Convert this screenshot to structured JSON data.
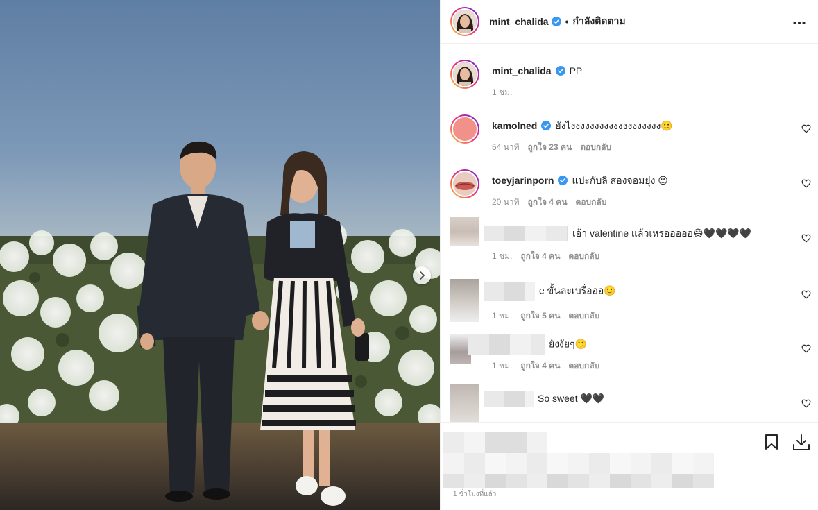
{
  "post_author": {
    "username": "mint_chalida",
    "follow_state": "กำลังติดตาม",
    "separator": "•"
  },
  "caption": {
    "username": "mint_chalida",
    "text": "PP",
    "time": "1 ชม."
  },
  "comments": [
    {
      "username": "kamolned",
      "text": "ยังไงงงงงงงงงงงงงงงงงงง🙂",
      "time": "54 นาที",
      "likes": "ถูกใจ 23 คน",
      "reply": "ตอบกลับ",
      "verified": true
    },
    {
      "username": "toeyjarinporn",
      "text": "แปะกับลิ สองจอมยุ่ง 😉",
      "time": "20 นาที",
      "likes": "ถูกใจ 4 คน",
      "reply": "ตอบกลับ",
      "verified": true
    },
    {
      "username": "",
      "text": "เอ้า valentine แล้วเหรอออออ😅🖤🖤🖤🖤",
      "time": "1 ชม.",
      "likes": "ถูกใจ 4 คน",
      "reply": "ตอบกลับ",
      "verified": false
    },
    {
      "username": "",
      "text": "e ขั้นละเบรื่อออ🙂",
      "time": "1 ชม.",
      "likes": "ถูกใจ 5 คน",
      "reply": "ตอบกลับ",
      "verified": false
    },
    {
      "username": "",
      "text": "ยังงัยๆ🙂",
      "time": "1 ชม.",
      "likes": "ถูกใจ 4 คน",
      "reply": "ตอบกลับ",
      "verified": false
    },
    {
      "username": "",
      "text": "So sweet 🖤🖤",
      "time": "",
      "likes": "",
      "reply": "",
      "verified": false
    }
  ],
  "footer": {
    "time": "1 ชั่วโมงที่แล้ว"
  },
  "icons": [
    "verified-badge-icon",
    "more-options-icon",
    "heart-icon",
    "next-arrow-icon",
    "save-bookmark-icon",
    "download-icon"
  ],
  "colors": {
    "verified": "#3897f0",
    "muted": "#8e8e8e",
    "text": "#262626"
  }
}
